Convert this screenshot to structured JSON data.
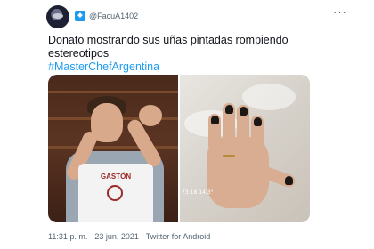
{
  "tweet": {
    "handle": "@FacuA1402",
    "text": "Donato mostrando sus uñas pintadas rompiendo estereotipos",
    "hashtag": "#MasterChefArgentina",
    "meta": "11:31 p. m. · 23 jun. 2021 · Twitter for Android",
    "more_icon": "more-icon"
  },
  "media": {
    "left_image": {
      "apron_name": "GASTÓN"
    },
    "right_image": {
      "overlay_left": "73:18",
      "overlay_right": "14.3°"
    }
  },
  "colors": {
    "accent": "#1d9bf0",
    "text": "#0f1419",
    "muted": "#536471"
  }
}
